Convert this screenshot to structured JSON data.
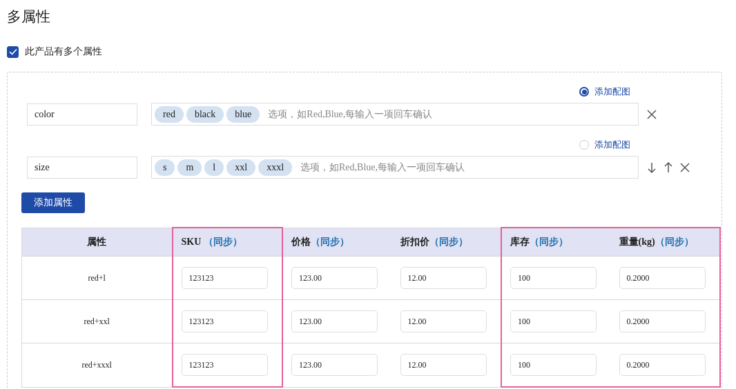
{
  "title": "多属性",
  "multi_attribute": {
    "label": "此产品有多个属性",
    "checked": true
  },
  "attributes": [
    {
      "name": "color",
      "image_label": "添加配图",
      "image_selected": true,
      "tags": [
        "red",
        "black",
        "blue"
      ],
      "placeholder": "选项，如Red,Blue,每输入一项回车确认",
      "actions": [
        {
          "kind": "close"
        }
      ]
    },
    {
      "name": "size",
      "image_label": "添加配图",
      "image_selected": false,
      "tags": [
        "s",
        "m",
        "l",
        "xxl",
        "xxxl"
      ],
      "placeholder": "选项，如Red,Blue,每输入一项回车确认",
      "actions": [
        {
          "kind": "down"
        },
        {
          "kind": "up"
        },
        {
          "kind": "close"
        }
      ]
    }
  ],
  "add_button": "添加属性",
  "table": {
    "columns": [
      {
        "label": "属性",
        "highlighted": false
      },
      {
        "label": "SKU ",
        "sync": "（同步）",
        "highlighted": true
      },
      {
        "label": "价格",
        "sync": "（同步）",
        "highlighted": false
      },
      {
        "label": "折扣价",
        "sync": "（同步）",
        "highlighted": false
      },
      {
        "label": "库存",
        "sync": "（同步）",
        "highlighted": true
      },
      {
        "label": "重量(kg)",
        "sync": "（同步）",
        "highlighted": true
      }
    ],
    "rows": [
      {
        "attribute": "red+l",
        "values": [
          "123123",
          "123.00",
          "12.00",
          "100",
          "0.2000"
        ]
      },
      {
        "attribute": "red+xxl",
        "values": [
          "123123",
          "123.00",
          "12.00",
          "100",
          "0.2000"
        ]
      },
      {
        "attribute": "red+xxxl",
        "values": [
          "123123",
          "123.00",
          "12.00",
          "100",
          "0.2000"
        ]
      }
    ]
  }
}
